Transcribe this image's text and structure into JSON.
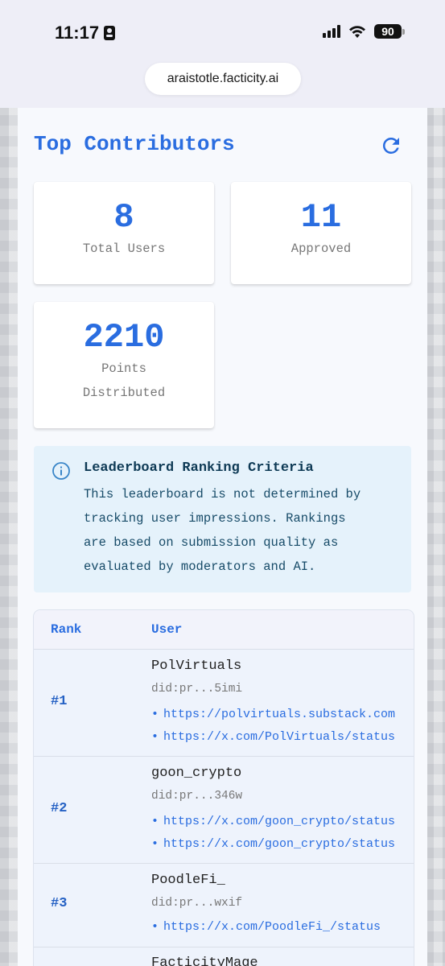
{
  "status_bar": {
    "time": "11:17",
    "battery": "90"
  },
  "browser": {
    "url": "araistotle.facticity.ai"
  },
  "header": {
    "title": "Top Contributors"
  },
  "stats": [
    {
      "value": "8",
      "label": "Total Users"
    },
    {
      "value": "11",
      "label": "Approved"
    },
    {
      "value": "2210",
      "label_line1": "Points",
      "label_line2": "Distributed"
    }
  ],
  "info": {
    "title": "Leaderboard Ranking Criteria",
    "line1": "This leaderboard is not determined by",
    "line2": "tracking user impressions. Rankings",
    "line3": "are based on submission quality as",
    "line4": "evaluated by moderators and AI."
  },
  "table": {
    "headers": {
      "rank": "Rank",
      "user": "User"
    },
    "rows": [
      {
        "rank": "#1",
        "name": "PolVirtuals",
        "did": "did:pr...5imi",
        "links": [
          "https://polvirtuals.substack.com",
          "https://x.com/PolVirtuals/status"
        ]
      },
      {
        "rank": "#2",
        "name": "goon_crypto",
        "did": "did:pr...346w",
        "links": [
          "https://x.com/goon_crypto/status",
          "https://x.com/goon_crypto/status"
        ]
      },
      {
        "rank": "#3",
        "name": "PoodleFi_",
        "did": "did:pr...wxif",
        "links": [
          "https://x.com/PoodleFi_/status"
        ]
      },
      {
        "rank": "",
        "name": "FacticityMage"
      }
    ]
  },
  "colors": {
    "accent": "#2a6de0",
    "info_bg": "#e5f2fb",
    "info_text": "#174b68"
  }
}
